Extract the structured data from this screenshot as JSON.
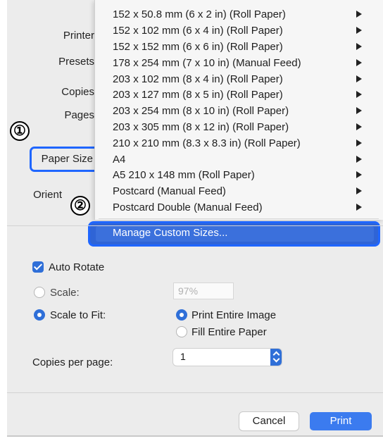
{
  "sidebar_labels": {
    "printer": "Printer",
    "presets": "Presets",
    "copies": "Copies",
    "pages": "Pages",
    "paper_size": "Paper Size",
    "orientation": "Orient"
  },
  "callouts": {
    "one": "①",
    "two": "②"
  },
  "paper_menu": {
    "items": [
      "152 x 50.8 mm (6 x 2 in) (Roll Paper)",
      "152 x 102 mm (6 x 4 in) (Roll Paper)",
      "152 x 152 mm (6 x 6 in) (Roll Paper)",
      "178 x 254 mm (7 x 10 in) (Manual Feed)",
      "203 x 102 mm (8 x 4 in) (Roll Paper)",
      "203 x 127 mm (8 x 5 in) (Roll Paper)",
      "203 x 254 mm (8 x 10 in) (Roll Paper)",
      "203 x 305 mm (8 x 12 in) (Roll Paper)",
      "210 x 210 mm (8.3 x 8.3 in) (Roll Paper)",
      "A4",
      "A5 210 x 148 mm (Roll Paper)",
      "Postcard (Manual Feed)",
      "Postcard Double (Manual Feed)"
    ],
    "manage_label": "Manage Custom Sizes..."
  },
  "options": {
    "auto_rotate_label": "Auto Rotate",
    "auto_rotate_checked": true,
    "scale_label": "Scale:",
    "scale_value": "97%",
    "scale_to_fit_label": "Scale to Fit:",
    "print_entire_image_label": "Print Entire Image",
    "fill_entire_paper_label": "Fill Entire Paper",
    "copies_per_page_label": "Copies per page:",
    "copies_per_page_value": "1"
  },
  "buttons": {
    "cancel": "Cancel",
    "print": "Print"
  },
  "colors": {
    "accent": "#2f6fd8",
    "highlight_border": "#1f66ff",
    "print_button": "#3b7bef"
  }
}
